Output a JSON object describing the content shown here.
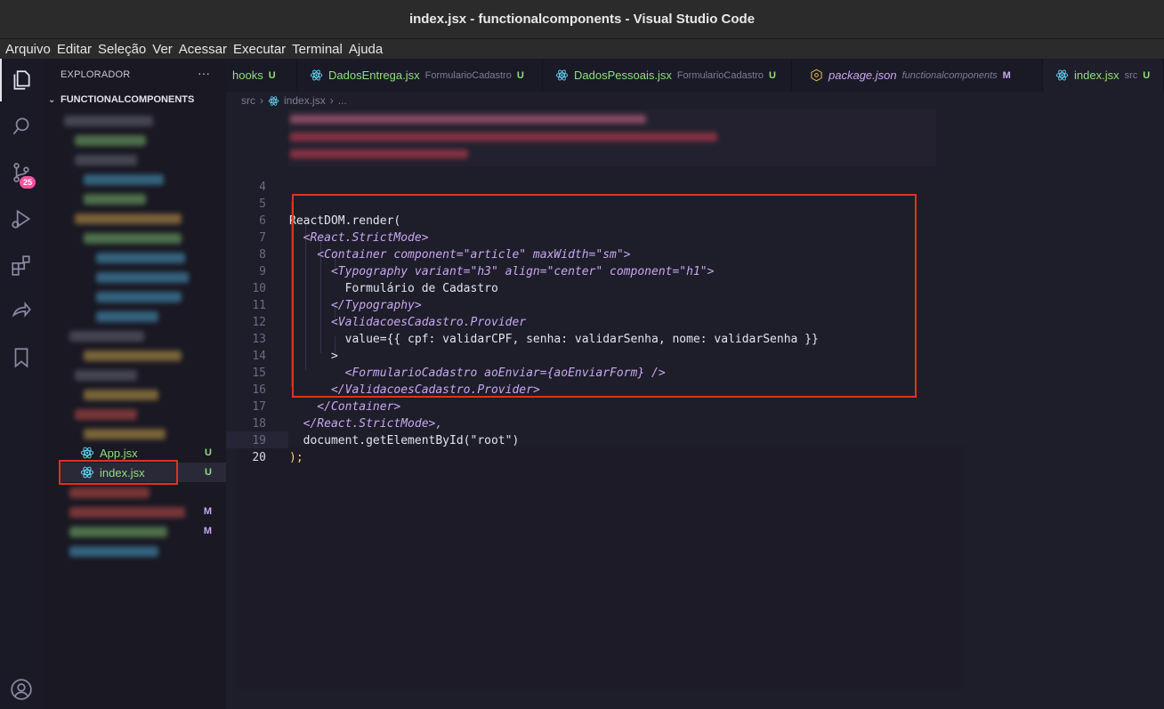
{
  "window": {
    "title": "index.jsx - functionalcomponents - Visual Studio Code"
  },
  "menu": [
    "Arquivo",
    "Editar",
    "Seleção",
    "Ver",
    "Acessar",
    "Executar",
    "Terminal",
    "Ajuda"
  ],
  "activity": {
    "scm_badge": "25"
  },
  "sidebar": {
    "header": "EXPLORADOR",
    "more": "···",
    "project": "FUNCTIONALCOMPONENTS",
    "files": [
      {
        "name": "App.jsx",
        "status": "U"
      },
      {
        "name": "index.jsx",
        "status": "U"
      }
    ],
    "blurred_status": [
      "M",
      "M"
    ]
  },
  "tabs": [
    {
      "name": "hooks",
      "path": "",
      "status": "U"
    },
    {
      "name": "DadosEntrega.jsx",
      "path": "FormularioCadastro",
      "status": "U"
    },
    {
      "name": "DadosPessoais.jsx",
      "path": "FormularioCadastro",
      "status": "U"
    },
    {
      "name": "package.json",
      "path": "functionalcomponents",
      "status": "M"
    },
    {
      "name": "index.jsx",
      "path": "src",
      "status": "U"
    }
  ],
  "breadcrumb": {
    "folder": "src",
    "file": "index.jsx",
    "more": "..."
  },
  "editor": {
    "line_numbers": [
      "4",
      "5",
      "6",
      "7",
      "8",
      "9",
      "10",
      "11",
      "12",
      "13",
      "14",
      "15",
      "16",
      "17",
      "18",
      "19",
      "20"
    ],
    "lines": [
      "",
      "ReactDOM.render(",
      "  <React.StrictMode>",
      "    <Container component=\"article\" maxWidth=\"sm\">",
      "      <Typography variant=\"h3\" align=\"center\" component=\"h1\">",
      "        Formulário de Cadastro",
      "      </Typography>",
      "      <ValidacoesCadastro.Provider",
      "        value={{ cpf: validarCPF, senha: validarSenha, nome: validarSenha }}",
      "      >",
      "        <FormularioCadastro aoEnviar={aoEnviarForm} />",
      "      </ValidacoesCadastro.Provider>",
      "    </Container>",
      "  </React.StrictMode>,",
      "  document.getElementById(\"root\")",
      ");",
      ""
    ]
  },
  "colors": {
    "highlight_box": "#e0321e",
    "untracked": "#8fe07a",
    "badge": "#ff4fa0"
  }
}
